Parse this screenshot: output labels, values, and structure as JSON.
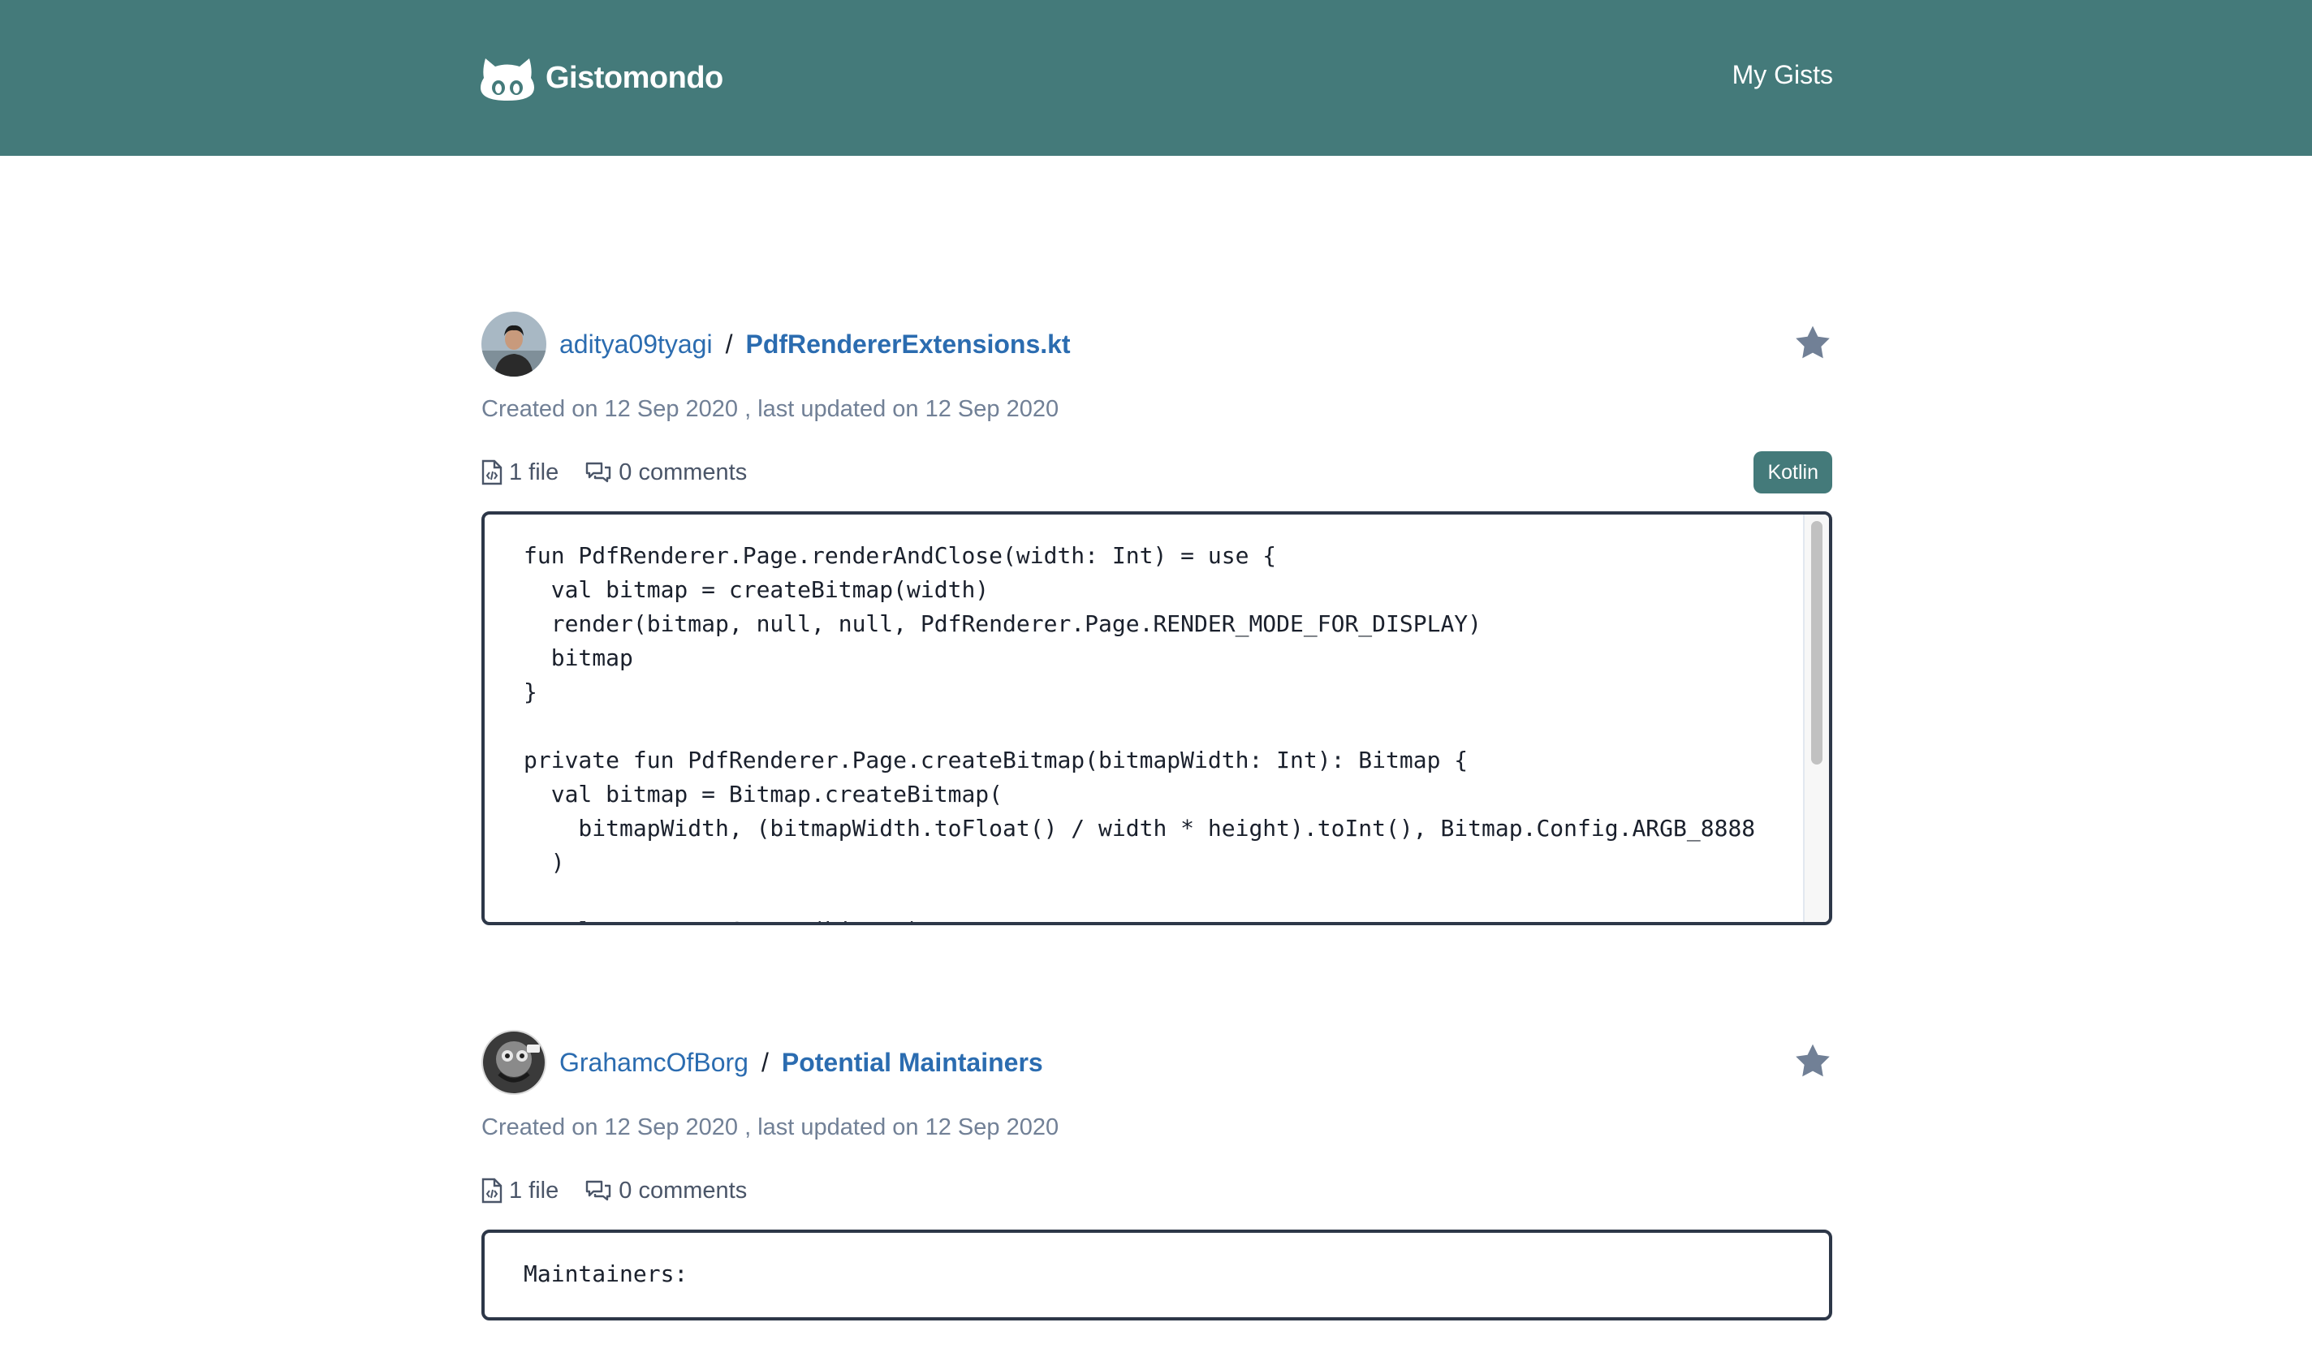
{
  "header": {
    "app_name": "Gistomondo",
    "nav_my_gists": "My Gists"
  },
  "gists": [
    {
      "owner": "aditya09tyagi",
      "separator": "/",
      "name": "PdfRendererExtensions.kt",
      "created": "Created on 12 Sep 2020",
      "updated": "last updated on 12 Sep 2020",
      "date_separator": ",",
      "files": "1 file",
      "comments": "0 comments",
      "language": "Kotlin",
      "code": "fun PdfRenderer.Page.renderAndClose(width: Int) = use {\n  val bitmap = createBitmap(width)\n  render(bitmap, null, null, PdfRenderer.Page.RENDER_MODE_FOR_DISPLAY)\n  bitmap\n}\n\nprivate fun PdfRenderer.Page.createBitmap(bitmapWidth: Int): Bitmap {\n  val bitmap = Bitmap.createBitmap(\n    bitmapWidth, (bitmapWidth.toFloat() / width * height).toInt(), Bitmap.Config.ARGB_8888\n  )\n\n  val canvas = Canvas(bitmap)"
    },
    {
      "owner": "GrahamcOfBorg",
      "separator": "/",
      "name": "Potential Maintainers",
      "created": "Created on 12 Sep 2020",
      "updated": "last updated on 12 Sep 2020",
      "date_separator": ",",
      "files": "1 file",
      "comments": "0 comments",
      "code": "Maintainers:"
    }
  ],
  "icons": {
    "logo": "octocat-icon",
    "star": "star-icon",
    "file": "file-code-icon",
    "comments": "comments-icon"
  },
  "colors": {
    "header_bg": "#447a7a",
    "link": "#2b6cb0",
    "muted": "#718096",
    "badge_bg": "#447a7a",
    "star": "#718096"
  }
}
